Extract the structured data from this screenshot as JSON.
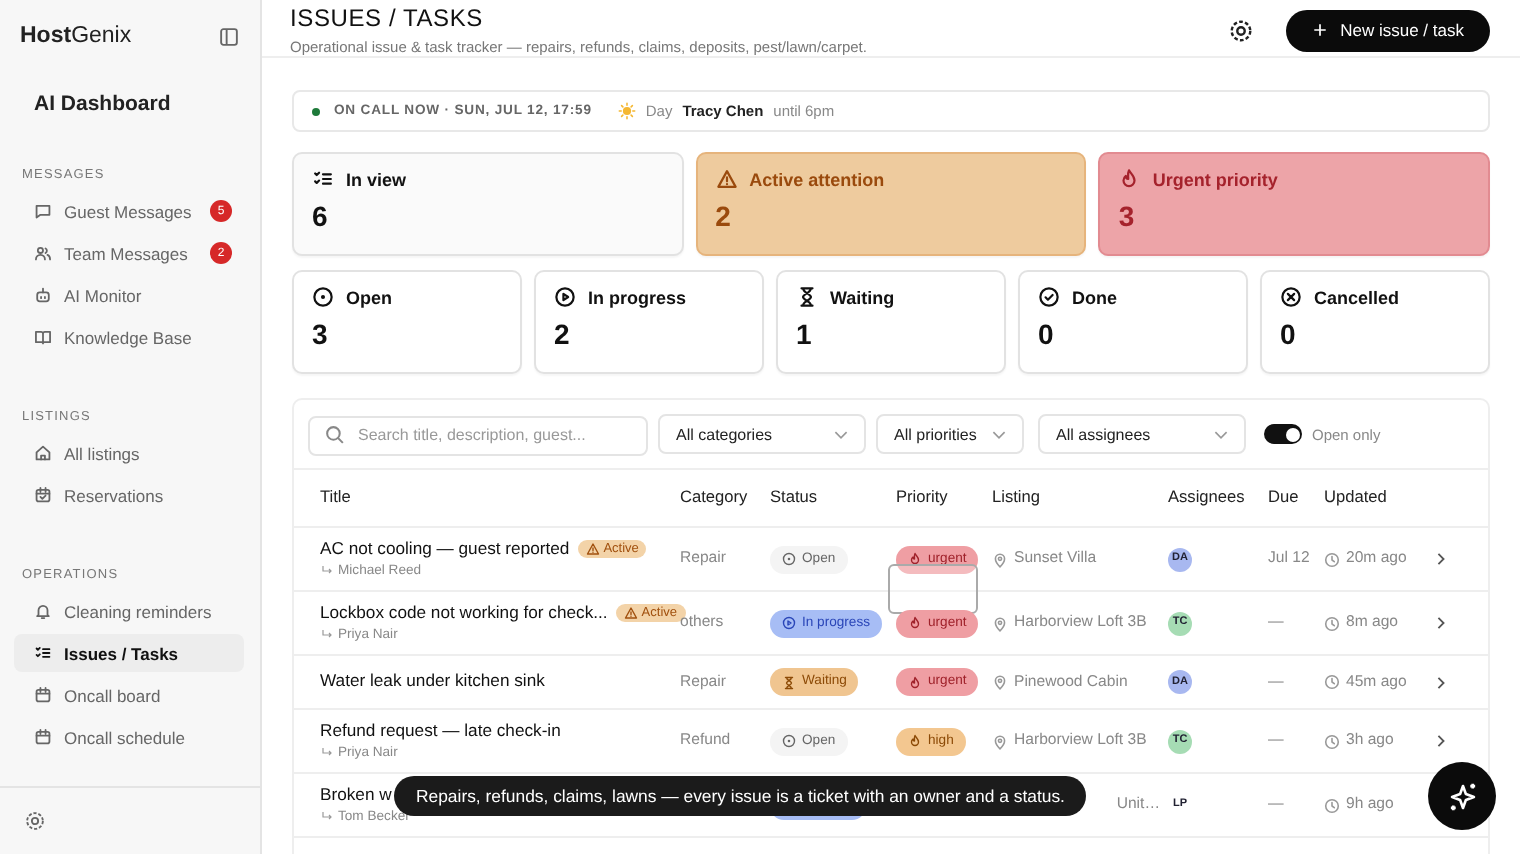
{
  "sidebar": {
    "logo": "**Host**Genix",
    "dashboard": "AI Dashboard",
    "sections": [
      {
        "title": "MESSAGES",
        "items": [
          {
            "label": "Guest Messages",
            "badge": "5",
            "selected": false
          },
          {
            "label": "Team Messages",
            "badge": "2",
            "selected": false
          },
          {
            "label": "AI Monitor",
            "selected": false
          },
          {
            "label": "Knowledge Base",
            "selected": false
          }
        ]
      },
      {
        "title": "LISTINGS",
        "items": [
          {
            "label": "All listings",
            "selected": false
          },
          {
            "label": "Reservations",
            "selected": false
          }
        ]
      },
      {
        "title": "OPERATIONS",
        "items": [
          {
            "label": "Cleaning reminders",
            "selected": false
          },
          {
            "label": "Issues / Tasks",
            "selected": true
          },
          {
            "label": "Oncall board",
            "selected": false
          },
          {
            "label": "Oncall schedule",
            "selected": false
          }
        ]
      }
    ]
  },
  "header": {
    "title": "ISSUES / TASKS",
    "subtitle": "Operational issue & task tracker — repairs, refunds, claims, deposits, pest/lawn/carpet.",
    "new_button": "New issue / task"
  },
  "oncall": {
    "label": "ON CALL NOW · SUN, JUL 12, 17:59",
    "shift": "Day",
    "person": "Tracy Chen",
    "until": "until 6pm"
  },
  "summary_cards": [
    {
      "label": "In view",
      "value": "6",
      "kind": "neutral"
    },
    {
      "label": "Active attention",
      "value": "2",
      "kind": "warning"
    },
    {
      "label": "Urgent priority",
      "value": "3",
      "kind": "danger"
    }
  ],
  "status_cards": [
    {
      "label": "Open",
      "value": "3"
    },
    {
      "label": "In progress",
      "value": "2"
    },
    {
      "label": "Waiting",
      "value": "1"
    },
    {
      "label": "Done",
      "value": "0"
    },
    {
      "label": "Cancelled",
      "value": "0"
    }
  ],
  "filters": {
    "search_placeholder": "Search title, description, guest...",
    "category": "All categories",
    "priority": "All priorities",
    "assignee": "All assignees",
    "open_only": {
      "label": "Open only",
      "on": true
    }
  },
  "table": {
    "columns": [
      "Title",
      "Category",
      "Status",
      "Priority",
      "Listing",
      "Assignees",
      "Due",
      "Updated"
    ],
    "rows": [
      {
        "title": "AC not cooling — guest reported",
        "active": "Active",
        "reporter": "Michael Reed",
        "category": "Repair",
        "status": {
          "label": "Open",
          "kind": "open"
        },
        "priority": {
          "label": "urgent",
          "kind": "urgent"
        },
        "listing": "Sunset Villa",
        "assignee": {
          "initials": "DA",
          "color": "#a8b8f0"
        },
        "due": "Jul 12",
        "updated": "20m ago"
      },
      {
        "title": "Lockbox code not working for check...",
        "active": "Active",
        "reporter": "Priya Nair",
        "category": "others",
        "status": {
          "label": "In progress",
          "kind": "in_progress"
        },
        "priority": {
          "label": "urgent",
          "kind": "urgent"
        },
        "listing": "Harborview Loft 3B",
        "assignee": {
          "initials": "TC",
          "color": "#a6dcb4"
        },
        "due": "—",
        "updated": "8m ago"
      },
      {
        "title": "Water leak under kitchen sink",
        "category": "Repair",
        "status": {
          "label": "Waiting",
          "kind": "waiting"
        },
        "priority": {
          "label": "urgent",
          "kind": "urgent"
        },
        "listing": "Pinewood Cabin",
        "assignee": {
          "initials": "DA",
          "color": "#a8b8f0"
        },
        "due": "—",
        "updated": "45m ago"
      },
      {
        "title": "Refund request — late check-in",
        "reporter": "Priya Nair",
        "category": "Refund",
        "status": {
          "label": "Open",
          "kind": "open"
        },
        "priority": {
          "label": "high",
          "kind": "high"
        },
        "listing": "Harborview Loft 3B",
        "assignee": {
          "initials": "TC",
          "color": "#a6dcb4"
        },
        "due": "—",
        "updated": "3h ago"
      },
      {
        "title": "Broken w",
        "reporter": "Tom Becker",
        "status": {
          "kind": "in_progress"
        },
        "listing": "Unit…",
        "assignee": {
          "initials": "LP"
        },
        "due": "—",
        "updated": "9h ago"
      }
    ]
  },
  "tooltip": "Repairs, refunds, claims, lawns — every issue is a ticket with an owner and a status."
}
